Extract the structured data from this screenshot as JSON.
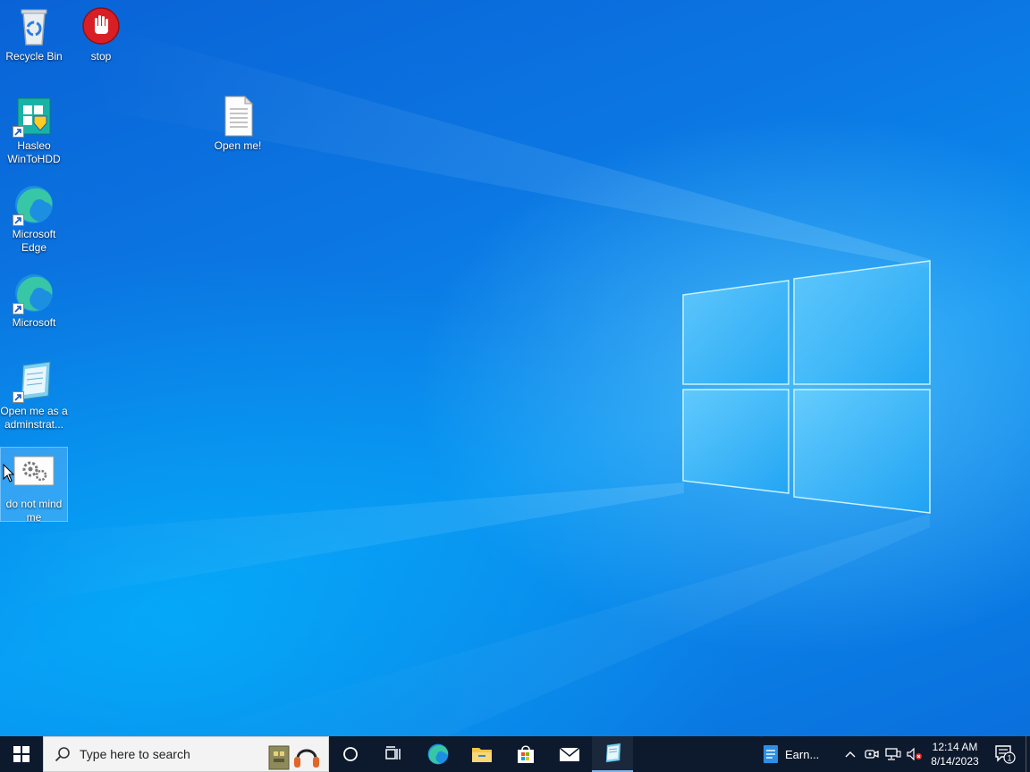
{
  "desktop": {
    "icons": [
      {
        "label": "Recycle Bin",
        "icon": "recycle-bin-icon"
      },
      {
        "label": "stop",
        "icon": "stop-hand-icon"
      },
      {
        "label": "Hasleo WinToHDD",
        "icon": "wintohdd-icon"
      },
      {
        "label": "Open me!",
        "icon": "text-file-icon"
      },
      {
        "label": "Microsoft Edge",
        "icon": "edge-icon"
      },
      {
        "label": "Microsoft",
        "icon": "edge-icon"
      },
      {
        "label": "Open me as a adminstrat...",
        "icon": "notepad-icon"
      },
      {
        "label": "do not mind me",
        "icon": "settings-gears-icon"
      }
    ]
  },
  "taskbar": {
    "search_placeholder": "Type here to search",
    "pinned": [
      {
        "name": "Microsoft Edge",
        "icon": "edge-icon"
      },
      {
        "name": "File Explorer",
        "icon": "folder-icon"
      },
      {
        "name": "Microsoft Store",
        "icon": "store-icon"
      },
      {
        "name": "Mail",
        "icon": "mail-icon"
      },
      {
        "name": "Notepad",
        "icon": "notepad-icon"
      }
    ],
    "running_app_label": "Earn...",
    "clock": {
      "time": "12:14 AM",
      "date": "8/14/2023"
    },
    "notification_count": "1"
  },
  "colors": {
    "taskbar_bg": "#0d1a2e",
    "desktop_accent": "#0b78e3",
    "search_bg": "#f3f3f3"
  }
}
